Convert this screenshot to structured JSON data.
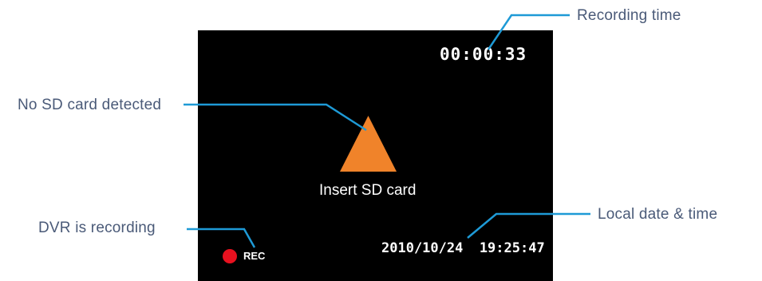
{
  "colors": {
    "screen_background": "#000000",
    "callout_text": "#4a5a78",
    "leader_line": "#1e9ad6",
    "warning_triangle": "#f0832a",
    "rec_indicator": "#e8111f",
    "overlay_text": "#ffffff"
  },
  "callouts": {
    "recording_time": "Recording time",
    "no_sd_card": "No SD card detected",
    "dvr_recording": "DVR is recording",
    "local_datetime": "Local date & time"
  },
  "screen": {
    "recording_timer": "00:00:33",
    "warning_icon": "warning-triangle",
    "insert_message": "Insert SD card",
    "rec_label": "REC",
    "datetime": "2010/10/24  19:25:47"
  }
}
